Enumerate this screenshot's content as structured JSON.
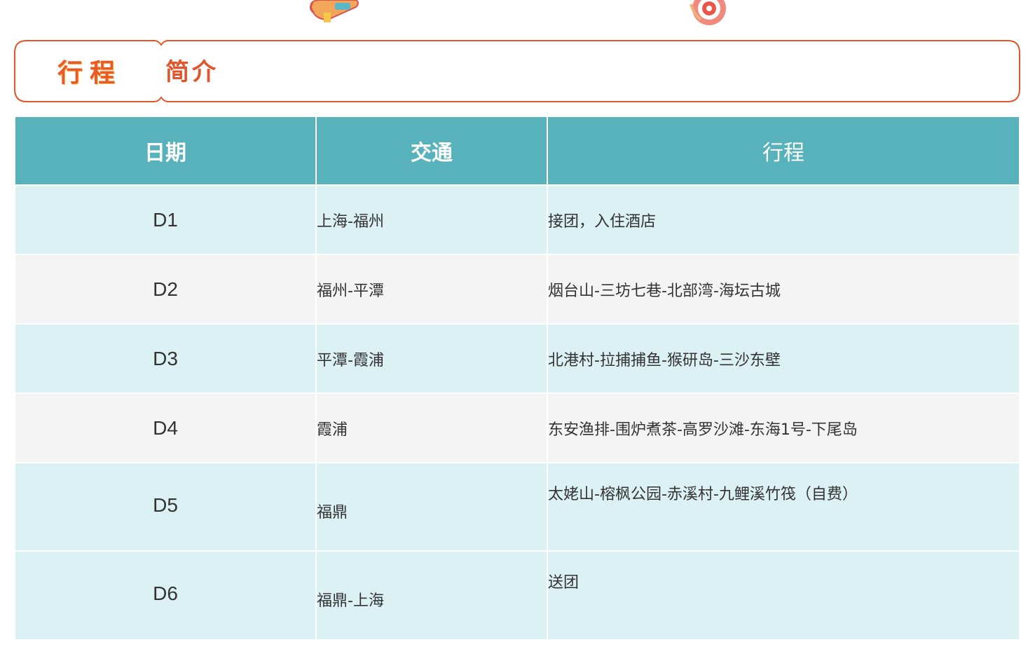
{
  "header": {
    "title_main": "行程",
    "title_sub": "简介"
  },
  "table": {
    "columns": [
      "日期",
      "交通",
      "行程"
    ],
    "rows": [
      {
        "day": "D1",
        "transport": "上海-福州",
        "plan": "接团，入住酒店"
      },
      {
        "day": "D2",
        "transport": "福州-平潭",
        "plan": "烟台山-三坊七巷-北部湾-海坛古城"
      },
      {
        "day": "D3",
        "transport": "平潭-霞浦",
        "plan": "北港村-拉捕捕鱼-猴研岛-三沙东壁"
      },
      {
        "day": "D4",
        "transport": "霞浦",
        "plan": "东安渔排-围炉煮茶-高罗沙滩-东海1号-下尾岛"
      },
      {
        "day": "D5",
        "transport": "福鼎",
        "plan": "太姥山-榕枫公园-赤溪村-九鲤溪竹筏（自费）"
      },
      {
        "day": "D6",
        "transport": "福鼎-上海",
        "plan": "送团"
      }
    ]
  },
  "colors": {
    "accent": "#e2542a",
    "header_bg": "#58b2bb",
    "row_cyan": "#dcf1f4",
    "row_gray": "#f4f4f4"
  },
  "icons": [
    "paint-tube-sticker-icon",
    "target-sticker-icon"
  ]
}
